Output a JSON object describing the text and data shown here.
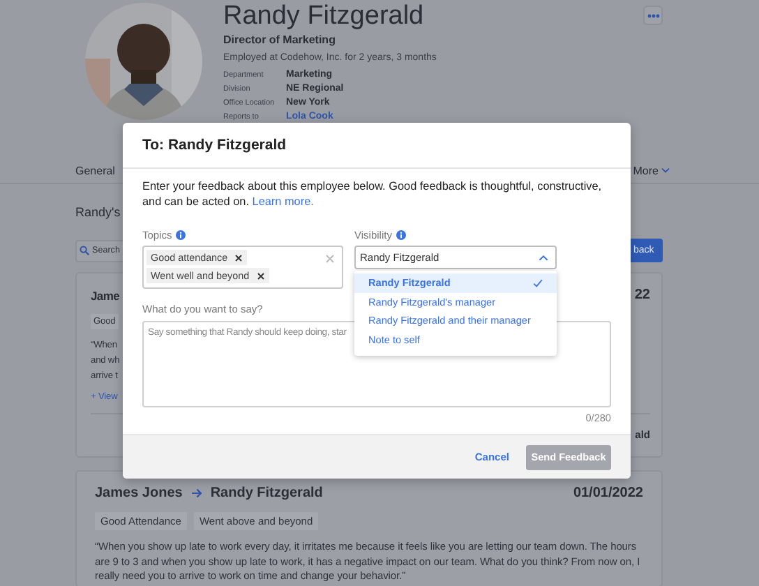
{
  "profile": {
    "name": "Randy Fitzgerald",
    "title": "Director of Marketing",
    "tenure": "Employed at Codehow, Inc. for 2 years, 3 months",
    "fields": [
      {
        "label": "Department",
        "value": "Marketing",
        "kind": "text"
      },
      {
        "label": "Division",
        "value": "NE Regional",
        "kind": "text"
      },
      {
        "label": "Office Location",
        "value": "New York",
        "kind": "text"
      },
      {
        "label": "Reports to",
        "value": "Lola Cook",
        "kind": "link"
      }
    ]
  },
  "nav_tabs": [
    "General",
    "More"
  ],
  "feedback_section": {
    "heading": "Randy's",
    "search": {
      "placeholder": "Search"
    },
    "give_button": "back"
  },
  "partial_card": {
    "author": "Jame",
    "date": "22",
    "tag": "Good",
    "lines": [
      "“When",
      "and wh",
      "arrive t"
    ],
    "link": "+ View",
    "footer": "ald"
  },
  "card": {
    "from": "James Jones",
    "to": "Randy Fitzgerald",
    "date": "01/01/2022",
    "tags": [
      "Good Attendance",
      "Went above and beyond"
    ],
    "quote": "“When you show up late to work every day, it irritates me because it feels like you are letting our team down. The hours are 9 to 3 and when you show up late to work, it has a negative impact on our team. What do you think? From now on, I really need you to arrive to work on time and change your behavior.”"
  },
  "modal": {
    "title": "To: Randy Fitzgerald",
    "intro": "Enter your feedback about this employee below. Good feedback is thoughtful, constructive, and can be acted on.",
    "learn_more": "Learn more.",
    "topics": {
      "label": "Topics",
      "tags": [
        "Good attendance",
        "Went well and beyond"
      ]
    },
    "visibility": {
      "label": "Visibility",
      "value": "Randy Fitzgerald",
      "expanded": true,
      "options": [
        {
          "label": "Randy Fitzgerald",
          "selected": true
        },
        {
          "label": "Randy Fitzgerald's manager",
          "selected": false
        },
        {
          "label": "Randy Fitzgerald and their manager",
          "selected": false
        },
        {
          "label": "Note to self",
          "selected": false
        }
      ]
    },
    "message": {
      "label": "What do you want to say?",
      "placeholder": "Say something that Randy should keep doing, star",
      "counter": "0/280"
    },
    "cancel": "Cancel",
    "send": {
      "label": "Send Feedback",
      "disabled": true
    }
  }
}
